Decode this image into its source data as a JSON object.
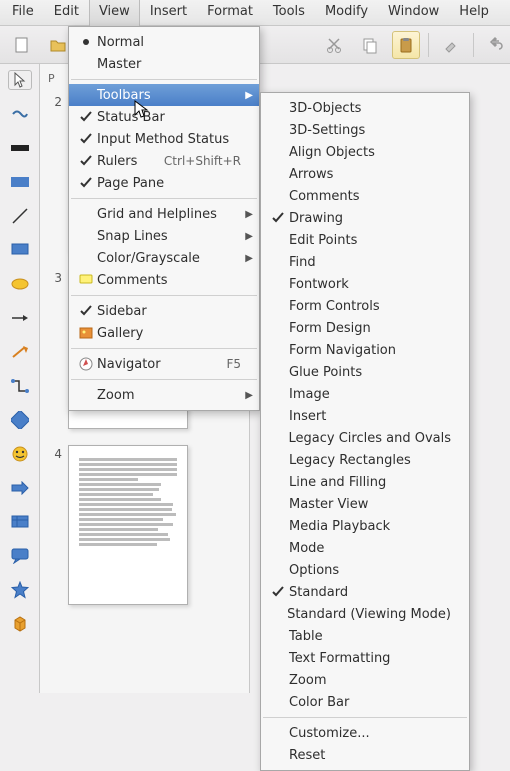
{
  "menubar": [
    "File",
    "Edit",
    "View",
    "Insert",
    "Format",
    "Tools",
    "Modify",
    "Window",
    "Help"
  ],
  "menubar_open_index": 2,
  "pages_heading": "P",
  "thumbs": [
    "2",
    "3",
    "4"
  ],
  "view_menu": {
    "items": [
      {
        "label": "Normal",
        "type": "radio",
        "checked": true
      },
      {
        "label": "Master",
        "type": "radio",
        "checked": false
      },
      {
        "sep": true
      },
      {
        "label": "Toolbars",
        "submenu": true,
        "highlight": true
      },
      {
        "label": "Status Bar",
        "type": "check",
        "checked": true
      },
      {
        "label": "Input Method Status",
        "type": "check",
        "checked": true
      },
      {
        "label": "Rulers",
        "type": "check",
        "checked": true,
        "accel": "Ctrl+Shift+R"
      },
      {
        "label": "Page Pane",
        "type": "check",
        "checked": true
      },
      {
        "sep": true
      },
      {
        "label": "Grid and Helplines",
        "submenu": true
      },
      {
        "label": "Snap Lines",
        "submenu": true
      },
      {
        "label": "Color/Grayscale",
        "submenu": true
      },
      {
        "label": "Comments",
        "icon": "comment"
      },
      {
        "sep": true
      },
      {
        "label": "Sidebar",
        "type": "check",
        "checked": true
      },
      {
        "label": "Gallery",
        "icon": "gallery"
      },
      {
        "sep": true
      },
      {
        "label": "Navigator",
        "icon": "navigator",
        "accel": "F5"
      },
      {
        "sep": true
      },
      {
        "label": "Zoom",
        "submenu": true
      }
    ]
  },
  "toolbars_menu": {
    "items": [
      {
        "label": "3D-Objects"
      },
      {
        "label": "3D-Settings"
      },
      {
        "label": "Align Objects"
      },
      {
        "label": "Arrows"
      },
      {
        "label": "Comments"
      },
      {
        "label": "Drawing",
        "checked": true
      },
      {
        "label": "Edit Points"
      },
      {
        "label": "Find"
      },
      {
        "label": "Fontwork"
      },
      {
        "label": "Form Controls"
      },
      {
        "label": "Form Design"
      },
      {
        "label": "Form Navigation"
      },
      {
        "label": "Glue Points"
      },
      {
        "label": "Image"
      },
      {
        "label": "Insert"
      },
      {
        "label": "Legacy Circles and Ovals"
      },
      {
        "label": "Legacy Rectangles"
      },
      {
        "label": "Line and Filling"
      },
      {
        "label": "Master View"
      },
      {
        "label": "Media Playback"
      },
      {
        "label": "Mode"
      },
      {
        "label": "Options"
      },
      {
        "label": "Standard",
        "checked": true
      },
      {
        "label": "Standard (Viewing Mode)"
      },
      {
        "label": "Table"
      },
      {
        "label": "Text Formatting"
      },
      {
        "label": "Zoom"
      },
      {
        "label": "Color Bar"
      },
      {
        "sep": true
      },
      {
        "label": "Customize..."
      },
      {
        "label": "Reset"
      }
    ]
  }
}
